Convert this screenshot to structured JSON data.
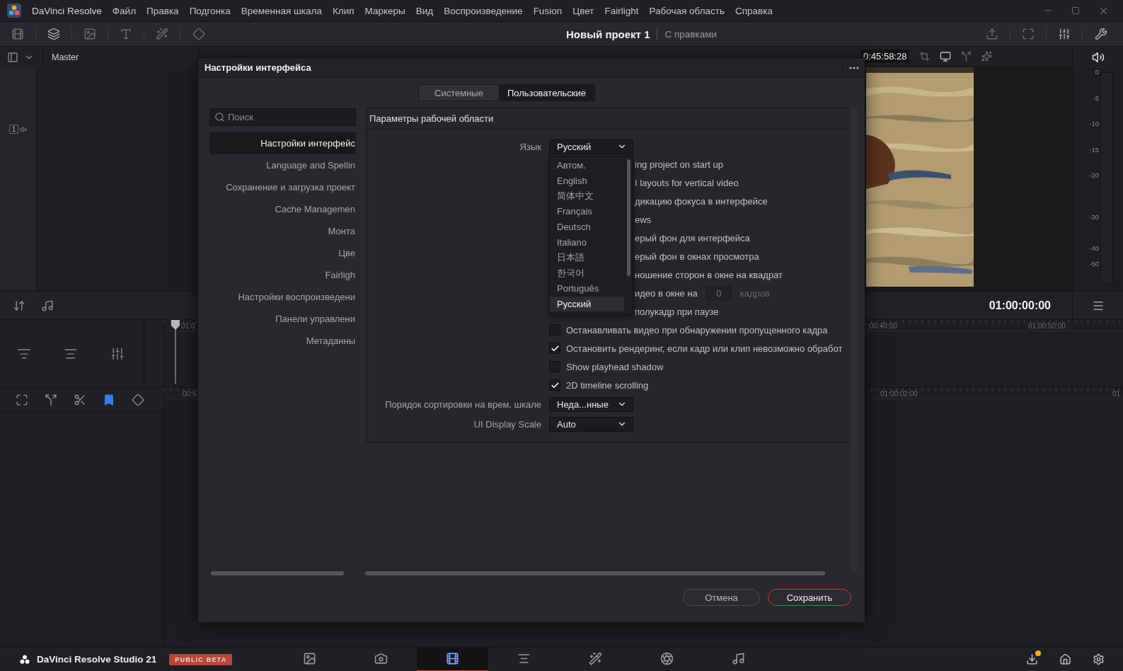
{
  "menu_bar": {
    "app_name": "DaVinci Resolve",
    "items": [
      "Файл",
      "Правка",
      "Подгонка",
      "Временная шкала",
      "Клип",
      "Маркеры",
      "Вид",
      "Воспроизведение",
      "Fusion",
      "Цвет",
      "Fairlight",
      "Рабочая область",
      "Справка"
    ]
  },
  "toolbar": {
    "project_title": "Новый проект 1",
    "project_status": "С правками"
  },
  "media_pool": {
    "bin": "Master",
    "track_badge": "1"
  },
  "viewer": {
    "timecode": "0:45:58:28",
    "meter_ticks": [
      "0",
      "-5",
      "-10",
      "-15",
      "-20",
      "-30",
      "-40",
      "-50"
    ]
  },
  "timeline": {
    "timecode": "01:00:00:00",
    "upper_ruler": [
      "01:0",
      ":00:40:00",
      "01:00:50:00"
    ],
    "lower_ruler": [
      "00:5",
      "01:00:02:00",
      "01"
    ]
  },
  "dialog": {
    "title": "Настройки интерфейса",
    "tabs": [
      {
        "label": "Системные",
        "selected": false
      },
      {
        "label": "Пользовательские",
        "selected": true
      }
    ],
    "search": {
      "placeholder": "Поиск"
    },
    "nav": [
      {
        "label": "Настройки интерфейс",
        "selected": true
      },
      {
        "label": "Language and Spellin",
        "selected": false
      },
      {
        "label": "Сохранение и загрузка проект",
        "selected": false
      },
      {
        "label": "Cache Managemen",
        "selected": false
      },
      {
        "label": "Монта",
        "selected": false
      },
      {
        "label": "Цве",
        "selected": false
      },
      {
        "label": "Fairligh",
        "selected": false
      },
      {
        "label": "Настройки воспроизведени",
        "selected": false
      },
      {
        "label": "Панели управлени",
        "selected": false
      },
      {
        "label": "Метаданны",
        "selected": false
      }
    ],
    "section_title": "Параметры рабочей области",
    "language": {
      "label": "Язык",
      "value": "Русский",
      "expanded": true,
      "options": [
        {
          "label": "Автом.",
          "selected": false
        },
        {
          "label": "English",
          "selected": false
        },
        {
          "label": "简体中文",
          "selected": false
        },
        {
          "label": "Français",
          "selected": false
        },
        {
          "label": "Deutsch",
          "selected": false
        },
        {
          "label": "Italiano",
          "selected": false
        },
        {
          "label": "日本語",
          "selected": false
        },
        {
          "label": "한국어",
          "selected": false
        },
        {
          "label": "Português",
          "selected": false
        },
        {
          "label": "Русский",
          "selected": true
        }
      ]
    },
    "options": [
      {
        "kind": "partial",
        "text": "ing project on start up"
      },
      {
        "kind": "partial",
        "text": "I layouts for vertical video"
      },
      {
        "kind": "partial",
        "text": "дикацию фокуса в интерфейсе"
      },
      {
        "kind": "partial",
        "text": "ews"
      },
      {
        "kind": "partial",
        "text": "ерый фон для интерфейса"
      },
      {
        "kind": "partial",
        "text": "ерый фон в окнах просмотра"
      },
      {
        "kind": "partial",
        "text": "ношение сторон в окне на квадрат"
      },
      {
        "kind": "frames",
        "text": "идео в окне на",
        "value": "0",
        "unit": "кадров"
      },
      {
        "kind": "partial",
        "text": "полукадр при паузе"
      },
      {
        "kind": "checkbox",
        "text": "Останавливать видео при обнаружении пропущенного кадра",
        "checked": false
      },
      {
        "kind": "checkbox",
        "text": "Остановить рендеринг, если кадр или клип невозможно обработ",
        "checked": true
      },
      {
        "kind": "checkbox",
        "text": "Show playhead shadow",
        "checked": false
      },
      {
        "kind": "checkbox",
        "text": "2D timeline scrolling",
        "checked": true
      }
    ],
    "selects": [
      {
        "label": "Порядок сортировки на врем. шкале",
        "value": "Неда...нные"
      },
      {
        "label": "UI Display Scale",
        "value": "Auto"
      }
    ],
    "buttons": [
      {
        "kind": "cancel",
        "label": "Отмена"
      },
      {
        "kind": "primary",
        "label": "Сохранить"
      }
    ]
  },
  "page_bar": {
    "product": "DaVinci Resolve Studio 21",
    "badge": "PUBLIC BETA",
    "pages": [
      {
        "kind": "media",
        "selected": false
      },
      {
        "kind": "cut",
        "selected": false
      },
      {
        "kind": "edit",
        "selected": true
      },
      {
        "kind": "fusion",
        "selected": false
      },
      {
        "kind": "color",
        "selected": false
      },
      {
        "kind": "fairlight",
        "selected": false
      },
      {
        "kind": "deliver",
        "selected": false
      }
    ]
  }
}
